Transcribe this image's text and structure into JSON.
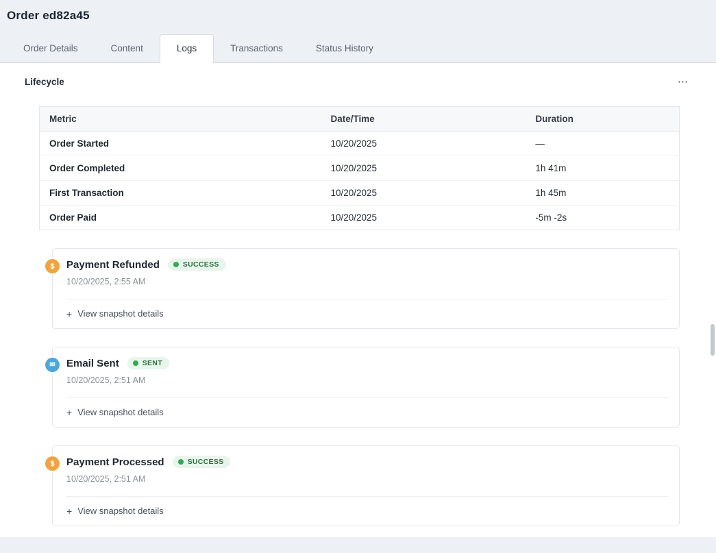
{
  "page": {
    "title": "Order ed82a45"
  },
  "tabs": [
    {
      "label": "Order Details",
      "active": false
    },
    {
      "label": "Content",
      "active": false
    },
    {
      "label": "Logs",
      "active": true
    },
    {
      "label": "Transactions",
      "active": false
    },
    {
      "label": "Status History",
      "active": false
    }
  ],
  "lifecycle": {
    "heading": "Lifecycle",
    "menu_glyph": "⋯",
    "table": {
      "headers": {
        "metric": "Metric",
        "datetime": "Date/Time",
        "duration": "Duration"
      },
      "rows": [
        {
          "metric": "Order Started",
          "datetime": "10/20/2025",
          "duration": "—"
        },
        {
          "metric": "Order Completed",
          "datetime": "10/20/2025",
          "duration": "1h 41m"
        },
        {
          "metric": "First Transaction",
          "datetime": "10/20/2025",
          "duration": "1h 45m"
        },
        {
          "metric": "Order Paid",
          "datetime": "10/20/2025",
          "duration": "-5m -2s"
        }
      ]
    }
  },
  "events": [
    {
      "title": "Payment Refunded",
      "badge": "SUCCESS",
      "icon": "dollar",
      "timestamp": "10/20/2025, 2:55 AM",
      "expand_label": "View snapshot details"
    },
    {
      "title": "Email Sent",
      "badge": "SENT",
      "icon": "email",
      "timestamp": "10/20/2025, 2:51 AM",
      "expand_label": "View snapshot details"
    },
    {
      "title": "Payment Processed",
      "badge": "SUCCESS",
      "icon": "dollar",
      "timestamp": "10/20/2025, 2:51 AM",
      "expand_label": "View snapshot details"
    }
  ],
  "icons": {
    "dollar": "$",
    "email": "✉",
    "plus": "+"
  },
  "colors": {
    "badge_bg": "#e8f5ec",
    "badge_text": "#2c6e3f",
    "badge_dot": "#34a853",
    "dollar_icon_bg": "#f0a43e",
    "email_icon_bg": "#4da7dc"
  }
}
